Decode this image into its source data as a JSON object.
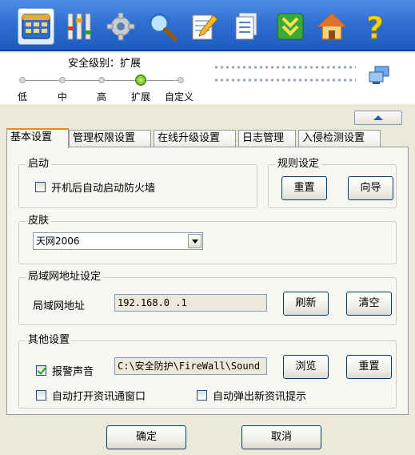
{
  "toolbar": {
    "buttons": [
      {
        "icon": "grid-icon",
        "active": true
      },
      {
        "icon": "sliders-icon"
      },
      {
        "icon": "gear-icon"
      },
      {
        "icon": "search-icon"
      },
      {
        "icon": "notepad-icon"
      },
      {
        "icon": "document-icon"
      },
      {
        "icon": "download-arrow-icon"
      },
      {
        "icon": "home-icon"
      },
      {
        "icon": "help-icon"
      }
    ]
  },
  "security_level": {
    "title": "安全级别：扩展",
    "levels": [
      "低",
      "中",
      "高",
      "扩展",
      "自定义"
    ],
    "selected": "扩展"
  },
  "tabs": [
    "基本设置",
    "管理权限设置",
    "在线升级设置",
    "日志管理",
    "入侵检测设置"
  ],
  "active_tab": "基本设置",
  "startup": {
    "title": "启动",
    "autostart_label": "开机后自动启动防火墙",
    "autostart_checked": false
  },
  "rules": {
    "title": "规则设定",
    "reset_label": "重置",
    "wizard_label": "向导"
  },
  "skin": {
    "title": "皮肤",
    "selected": "天网2006"
  },
  "lan": {
    "title": "局域网地址设定",
    "address_label": "局域网地址",
    "address_value": "192.168.0  .1",
    "refresh_label": "刷新",
    "clear_label": "清空"
  },
  "other": {
    "title": "其他设置",
    "alarm_label": "报警声音",
    "alarm_checked": true,
    "sound_path": "C:\\安全防护\\FireWall\\Sound",
    "browse_label": "浏览",
    "reset_label": "重置",
    "auto_open_label": "自动打开资讯通窗口",
    "auto_open_checked": false,
    "auto_popup_label": "自动弹出新资讯提示",
    "auto_popup_checked": false
  },
  "footer": {
    "ok_label": "确定",
    "cancel_label": "取消"
  }
}
